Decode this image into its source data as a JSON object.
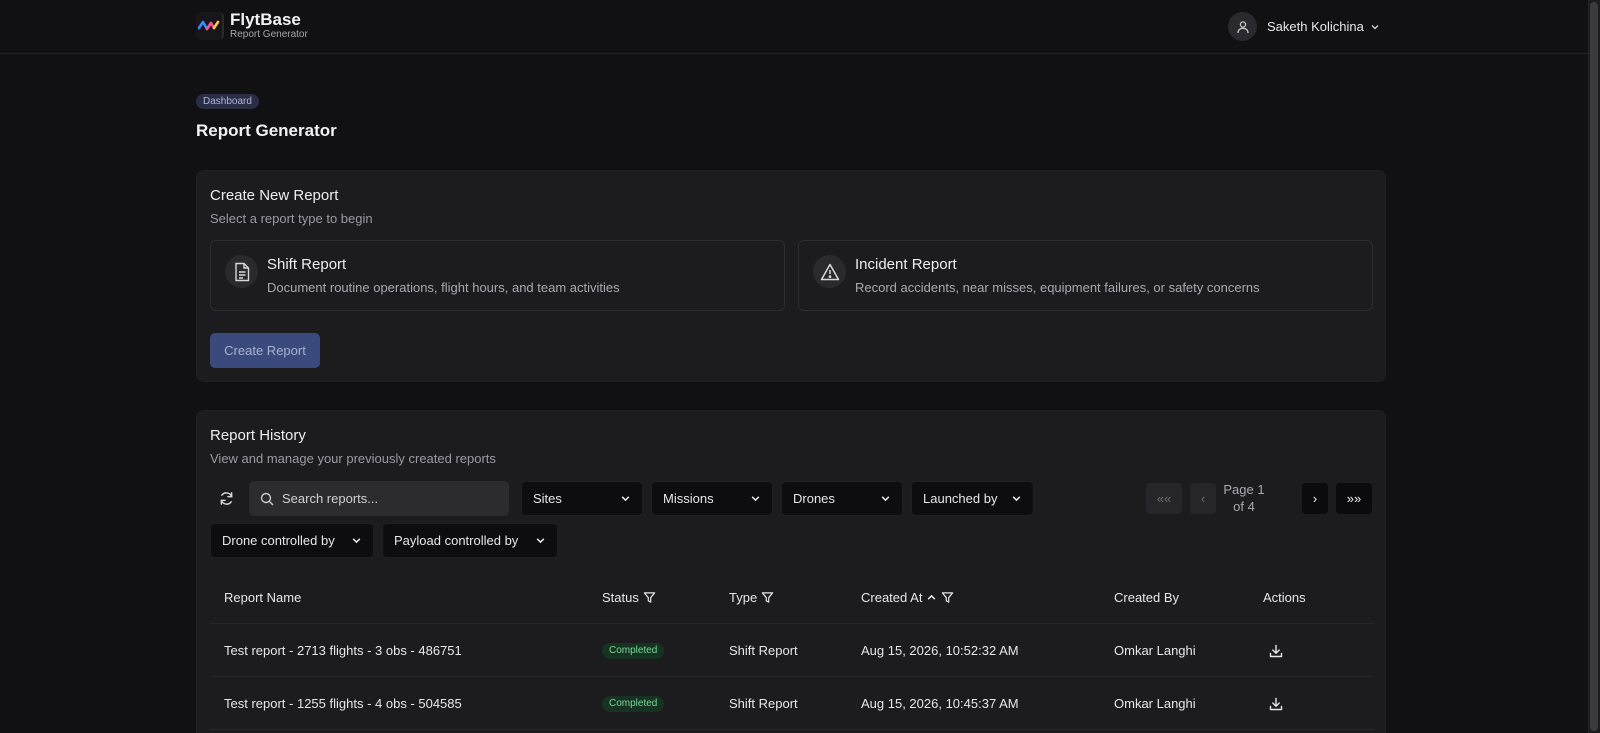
{
  "header": {
    "brand_name": "FlytBase",
    "brand_sub": "Report Generator",
    "user_name": "Saketh Kolichina"
  },
  "breadcrumb": "Dashboard",
  "page_title": "Report Generator",
  "create_card": {
    "title": "Create New Report",
    "subtitle": "Select a report type to begin",
    "types": [
      {
        "title": "Shift Report",
        "desc": "Document routine operations, flight hours, and team activities",
        "icon": "document-icon"
      },
      {
        "title": "Incident Report",
        "desc": "Record accidents, near misses, equipment failures, or safety concerns",
        "icon": "warning-icon"
      }
    ],
    "button_label": "Create Report"
  },
  "history": {
    "title": "Report History",
    "subtitle": "View and manage your previously created reports",
    "search_placeholder": "Search reports...",
    "filters": {
      "sites": "Sites",
      "missions": "Missions",
      "drones": "Drones",
      "launched_by": "Launched by",
      "drone_controlled_by": "Drone controlled by",
      "payload_controlled_by": "Payload controlled by"
    },
    "pagination": {
      "first": "««",
      "prev": "‹",
      "next": "›",
      "last": "»»",
      "page_line1": "Page 1",
      "page_line2": "of 4"
    },
    "columns": {
      "name": "Report Name",
      "status": "Status",
      "type": "Type",
      "created_at": "Created At",
      "created_by": "Created By",
      "actions": "Actions"
    },
    "rows": [
      {
        "name": "Test report - 2713 flights - 3 obs - 486751",
        "status": "Completed",
        "type": "Shift Report",
        "created_at": "Aug 15, 2026, 10:52:32 AM",
        "created_by": "Omkar Langhi"
      },
      {
        "name": "Test report - 1255 flights - 4 obs - 504585",
        "status": "Completed",
        "type": "Shift Report",
        "created_at": "Aug 15, 2026, 10:45:37 AM",
        "created_by": "Omkar Langhi"
      }
    ]
  },
  "colors": {
    "background": "#111113",
    "card": "#1c1c1f",
    "accent_button": "#3b4a7c",
    "status_completed": "#7bd59a"
  }
}
